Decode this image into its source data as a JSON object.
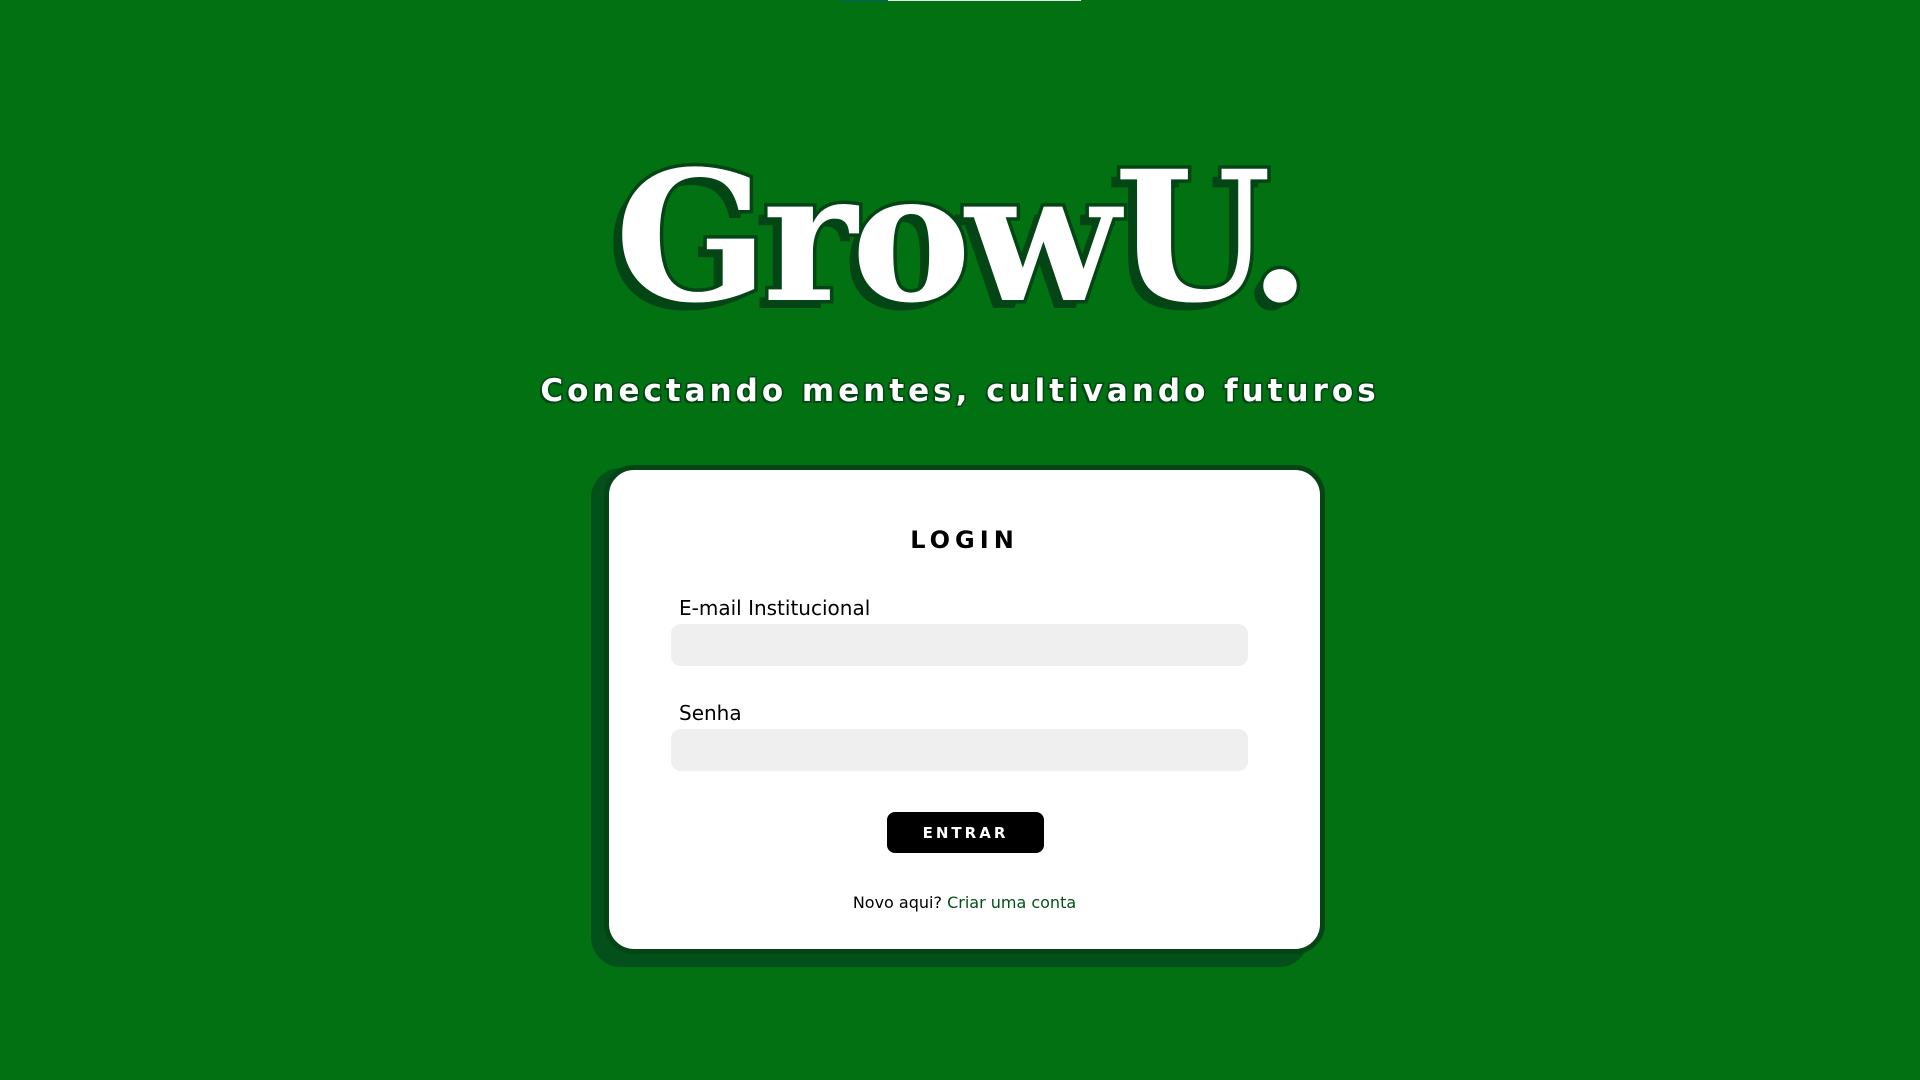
{
  "brand": {
    "logo_text": "GrowU.",
    "tagline": "Conectando mentes, cultivando futuros"
  },
  "login": {
    "title": "LOGIN",
    "email_label": "E-mail Institucional",
    "email_value": "",
    "email_placeholder": "",
    "password_label": "Senha",
    "password_value": "",
    "password_placeholder": "",
    "submit_label": "ENTRAR",
    "signup_prompt": "Novo aqui?",
    "signup_link": "Criar uma conta"
  },
  "colors": {
    "background": "#027112",
    "dark_green": "#034515",
    "card": "#ffffff",
    "input_bg": "#efefef",
    "button": "#000000"
  }
}
